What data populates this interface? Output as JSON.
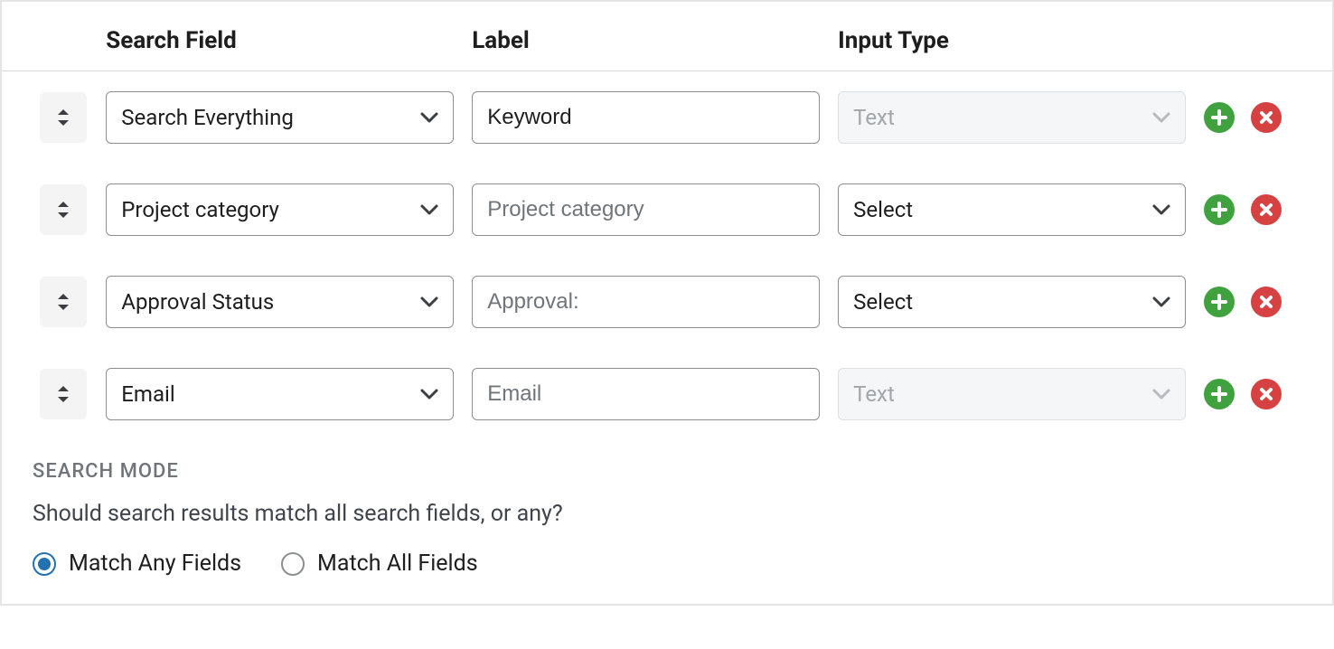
{
  "headers": {
    "field": "Search Field",
    "label": "Label",
    "type": "Input Type"
  },
  "rows": [
    {
      "field": "Search Everything",
      "label_value": "Keyword",
      "label_placeholder": "",
      "type": "Text",
      "type_disabled": true
    },
    {
      "field": "Project category",
      "label_value": "",
      "label_placeholder": "Project category",
      "type": "Select",
      "type_disabled": false
    },
    {
      "field": "Approval Status",
      "label_value": "",
      "label_placeholder": "Approval:",
      "type": "Select",
      "type_disabled": false
    },
    {
      "field": "Email",
      "label_value": "",
      "label_placeholder": "Email",
      "type": "Text",
      "type_disabled": true
    }
  ],
  "mode": {
    "title": "SEARCH MODE",
    "description": "Should search results match all search fields, or any?",
    "options": {
      "any": "Match Any Fields",
      "all": "Match All Fields"
    },
    "selected": "any"
  }
}
